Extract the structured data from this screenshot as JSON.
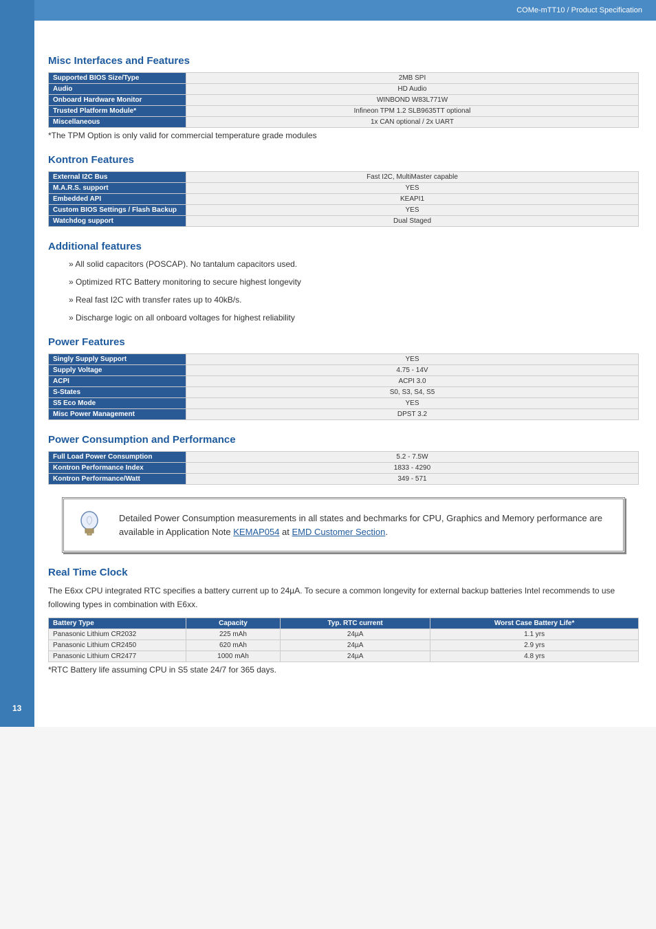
{
  "header": {
    "title": "COMe-mTT10 / Product Specification"
  },
  "page_number": "13",
  "sections": {
    "misc": {
      "heading": "Misc Interfaces and Features",
      "rows": [
        {
          "label": "Supported BIOS Size/Type",
          "value": "2MB SPI"
        },
        {
          "label": "Audio",
          "value": "HD Audio"
        },
        {
          "label": "Onboard Hardware Monitor",
          "value": "WINBOND W83L771W"
        },
        {
          "label": "Trusted Platform Module*",
          "value": "Infineon TPM 1.2 SLB9635TT optional"
        },
        {
          "label": "Miscellaneous",
          "value": "1x CAN optional / 2x UART"
        }
      ],
      "note": "*The TPM Option is only valid for commercial temperature grade modules"
    },
    "kontron": {
      "heading": "Kontron Features",
      "rows": [
        {
          "label": "External I2C Bus",
          "value": "Fast I2C, MultiMaster capable"
        },
        {
          "label": "M.A.R.S. support",
          "value": "YES"
        },
        {
          "label": "Embedded API",
          "value": "KEAPI1"
        },
        {
          "label": "Custom BIOS Settings / Flash Backup",
          "value": "YES"
        },
        {
          "label": "Watchdog support",
          "value": "Dual Staged"
        }
      ]
    },
    "additional": {
      "heading": "Additional features",
      "bullets": [
        "» All solid capacitors (POSCAP). No tantalum capacitors used.",
        "» Optimized RTC Battery monitoring to secure highest longevity",
        "» Real fast I2C with transfer rates up to 40kB/s.",
        "» Discharge logic on all onboard voltages for highest reliability"
      ]
    },
    "power": {
      "heading": "Power Features",
      "rows": [
        {
          "label": "Singly Supply Support",
          "value": "YES"
        },
        {
          "label": "Supply Voltage",
          "value": "4.75 - 14V"
        },
        {
          "label": "ACPI",
          "value": "ACPI 3.0"
        },
        {
          "label": "S-States",
          "value": "S0, S3, S4, S5"
        },
        {
          "label": "S5 Eco Mode",
          "value": "YES"
        },
        {
          "label": "Misc Power Management",
          "value": "DPST 3.2"
        }
      ]
    },
    "consumption": {
      "heading": "Power Consumption and Performance",
      "rows": [
        {
          "label": "Full Load Power Consumption",
          "value": "5.2 - 7.5W"
        },
        {
          "label": "Kontron Performance Index",
          "value": "1833 - 4290"
        },
        {
          "label": "Kontron Performance/Watt",
          "value": "349 - 571"
        }
      ]
    },
    "infobox": {
      "text_pre": "Detailed Power Consumption measurements in all states and bechmarks for CPU, Graphics and Memory performance are available in Application Note ",
      "link1": "KEMAP054",
      "text_mid": " at ",
      "link2": "EMD Customer Section",
      "text_post": "."
    },
    "rtc": {
      "heading": "Real Time Clock",
      "para": "The E6xx CPU integrated RTC specifies a battery current up to 24µA. To secure a common longevity for external backup batteries Intel recommends to use following types in combination with E6xx.",
      "headers": {
        "c1": "Battery Type",
        "c2": "Capacity",
        "c3": "Typ. RTC current",
        "c4": "Worst Case Battery Life*"
      },
      "rows": [
        {
          "c1": "Panasonic Lithium CR2032",
          "c2": "225 mAh",
          "c3": "24µA",
          "c4": "1.1 yrs"
        },
        {
          "c1": "Panasonic Lithium CR2450",
          "c2": "620 mAh",
          "c3": "24µA",
          "c4": "2.9 yrs"
        },
        {
          "c1": "Panasonic Lithium CR2477",
          "c2": "1000 mAh",
          "c3": "24µA",
          "c4": "4.8 yrs"
        }
      ],
      "note": "*RTC Battery life assuming CPU in S5 state 24/7 for 365 days."
    }
  }
}
